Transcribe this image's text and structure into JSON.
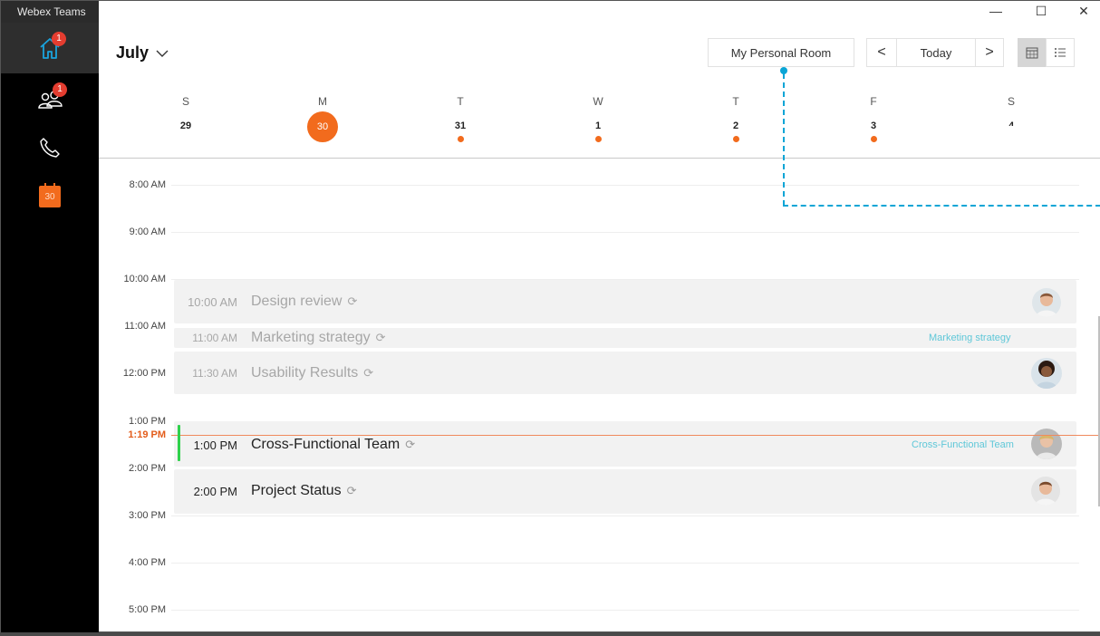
{
  "app": {
    "title": "Webex Teams"
  },
  "window_controls": {
    "minimize": "—",
    "maximize": "☐",
    "close": "✕"
  },
  "sidebar": {
    "items": [
      {
        "name": "home",
        "icon": "home-icon",
        "badge": "1",
        "active": true
      },
      {
        "name": "teams",
        "icon": "people-icon",
        "badge": "1",
        "active": false
      },
      {
        "name": "calls",
        "icon": "phone-icon",
        "badge": "",
        "active": false
      },
      {
        "name": "calendar",
        "icon": "calendar-icon",
        "label": "30",
        "active": false
      }
    ]
  },
  "header": {
    "month": "July",
    "personal_room": "My Personal Room",
    "prev": "<",
    "today": "Today",
    "next": ">",
    "view_calendar_icon": "calendar-view-icon",
    "view_list_icon": "list-view-icon"
  },
  "week": {
    "days": [
      {
        "letter": "S",
        "number": "29",
        "dot": false,
        "today": false
      },
      {
        "letter": "M",
        "number": "30",
        "dot": false,
        "today": true
      },
      {
        "letter": "T",
        "number": "31",
        "dot": true,
        "today": false
      },
      {
        "letter": "W",
        "number": "1",
        "dot": true,
        "today": false
      },
      {
        "letter": "T",
        "number": "2",
        "dot": true,
        "today": false
      },
      {
        "letter": "F",
        "number": "3",
        "dot": true,
        "today": false
      },
      {
        "letter": "S",
        "number": "4",
        "dot": false,
        "today": false
      }
    ]
  },
  "timeline": {
    "hours": [
      "8:00 AM",
      "9:00 AM",
      "10:00 AM",
      "11:00 AM",
      "12:00 PM",
      "1:00 PM",
      "2:00 PM",
      "3:00 PM",
      "4:00 PM",
      "5:00 PM"
    ],
    "now": "1:19 PM"
  },
  "events": [
    {
      "time": "10:00 AM",
      "title": "Design review",
      "tag": "",
      "avatar": true,
      "past": true
    },
    {
      "time": "11:00 AM",
      "title": "Marketing strategy",
      "tag": "Marketing strategy",
      "avatar": false,
      "past": true
    },
    {
      "time": "11:30 AM",
      "title": "Usability Results",
      "tag": "",
      "avatar": true,
      "past": true
    },
    {
      "time": "1:00 PM",
      "title": "Cross-Functional Team",
      "tag": "Cross-Functional Team",
      "avatar": true,
      "past": false
    },
    {
      "time": "2:00 PM",
      "title": "Project Status",
      "tag": "",
      "avatar": true,
      "past": false
    }
  ],
  "colors": {
    "accent": "#f26b1d",
    "badge": "#e43d30",
    "now_marker": "#2fd14b",
    "tag": "#5ec7d8",
    "connector": "#0aa5d6"
  }
}
